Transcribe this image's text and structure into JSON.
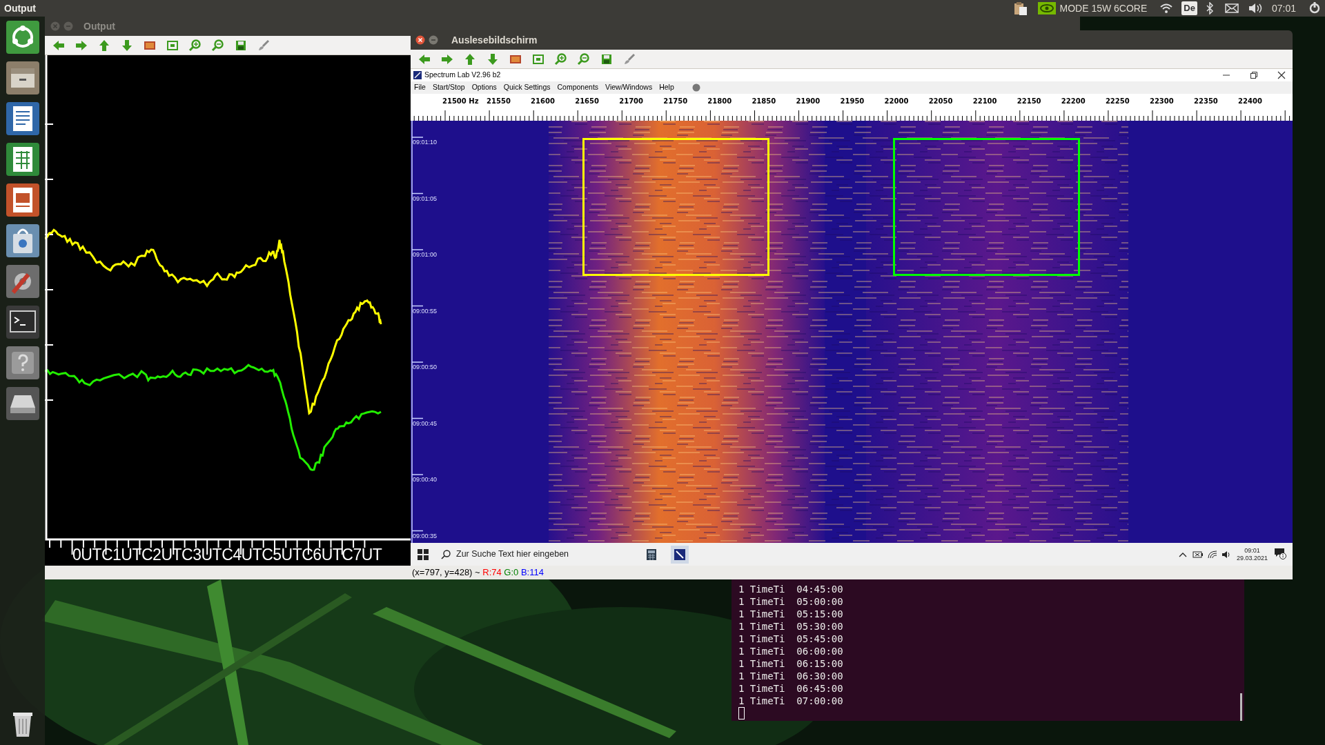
{
  "top_panel": {
    "title": "Output",
    "mode": "MODE 15W 6CORE",
    "keyboard": "De",
    "clock": "07:01"
  },
  "output_window": {
    "title": "Output",
    "x_axis_label": "0UTC1UTC2UTC3UTC4UTC5UTC6UTC7UT"
  },
  "spectrum_window": {
    "title": "Auslesebildschirm",
    "app_title": "Spectrum Lab V2.96 b2",
    "menu": [
      "File",
      "Start/Stop",
      "Options",
      "Quick Settings",
      "Components",
      "View/Windows",
      "Help"
    ],
    "freq_labels": [
      "21500 Hz",
      "21550",
      "21600",
      "21650",
      "21700",
      "21750",
      "21800",
      "21850",
      "21900",
      "21950",
      "22000",
      "22050",
      "22100",
      "22150",
      "22200",
      "22250",
      "22300",
      "22350",
      "22400"
    ],
    "time_labels": [
      "09:01:10",
      "09:01:05",
      "09:01:00",
      "09:00:55",
      "09:00:50",
      "09:00:45",
      "09:00:40",
      "09:00:35"
    ],
    "markers": [
      {
        "color": "#ffff00"
      },
      {
        "color": "#00ff00"
      }
    ]
  },
  "taskbar": {
    "search_placeholder": "Zur Suche Text hier eingeben",
    "time": "09:01",
    "date": "29.03.2021",
    "notifications": "1"
  },
  "status_line": {
    "position": "(x=797, y=428) ~",
    "channels": [
      {
        "text": "R:74",
        "color": "#ff0000"
      },
      {
        "text": "G:0",
        "color": "#008000"
      },
      {
        "text": "B:114",
        "color": "#0000ff"
      }
    ]
  },
  "terminal": {
    "lines": [
      "1 TimeTi  04:45:00",
      "1 TimeTi  05:00:00",
      "1 TimeTi  05:15:00",
      "1 TimeTi  05:30:00",
      "1 TimeTi  05:45:00",
      "1 TimeTi  06:00:00",
      "1 TimeTi  06:15:00",
      "1 TimeTi  06:30:00",
      "1 TimeTi  06:45:00",
      "1 TimeTi  07:00:00"
    ]
  }
}
